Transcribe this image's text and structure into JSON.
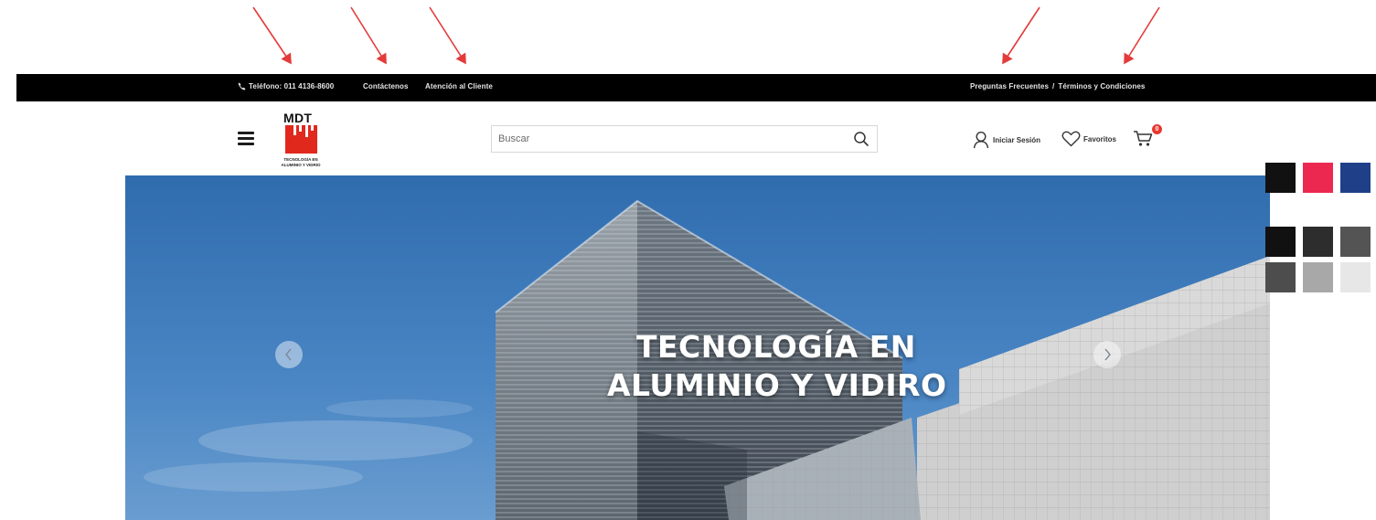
{
  "topbar": {
    "phone": "Teléfono: 011 4136-8600",
    "contact": "Contáctenos",
    "support": "Atención al Cliente",
    "faq": "Preguntas Frecuentes",
    "separator": "/",
    "terms": "Términos y Condiciones"
  },
  "header": {
    "logo": {
      "brand": "MDT",
      "tagline_1": "TECNOLOGÍA EN",
      "tagline_2": "ALUMINIO Y VIDRIO"
    },
    "search": {
      "placeholder": "Buscar"
    },
    "login_label": "Iniciar Sesión",
    "favorites_label": "Favoritos",
    "cart_count": "0"
  },
  "hero": {
    "title_line_1": "TECNOLOGÍA EN",
    "title_line_2": "ALUMINIO Y VIDIRO"
  },
  "swatches": {
    "row_1": [
      "#111111",
      "#ec2750",
      "#1f4088"
    ],
    "row_2": [
      "#111111",
      "#2d2d2d",
      "#545454"
    ],
    "row_3": [
      "#4d4d4d",
      "#a8a8a8",
      "#e7e7e7"
    ]
  },
  "colors": {
    "arrow": "#e53a3a",
    "topbar": "#000000",
    "accent": "#e0281d"
  }
}
